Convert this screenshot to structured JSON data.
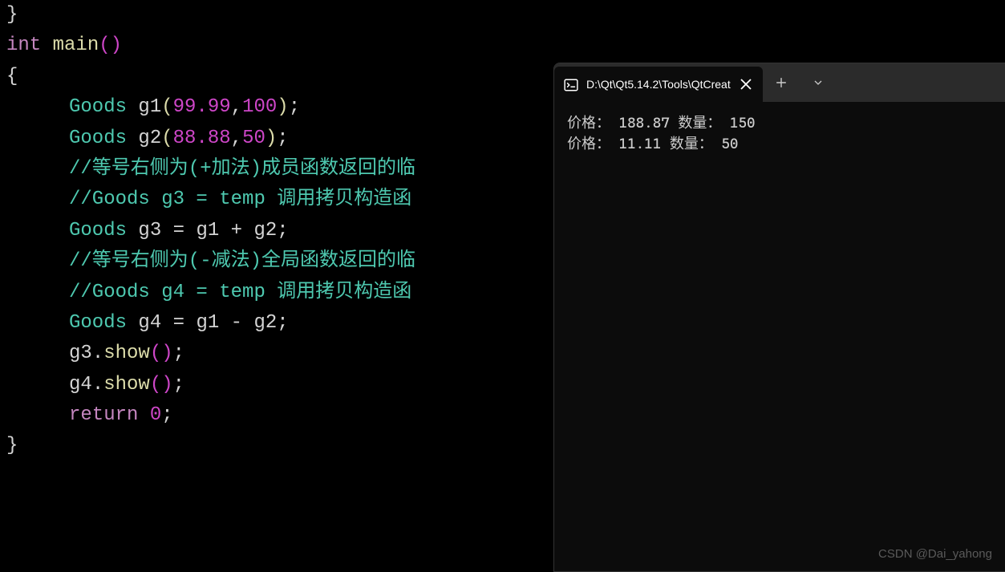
{
  "code": {
    "line0": "}",
    "kw_int": "int",
    "main": "main",
    "paren_open": "(",
    "paren_close": ")",
    "brace_open": "{",
    "brace_close": "}",
    "Goods": "Goods",
    "g1": "g1",
    "g1_v1": "99.99",
    "g1_v2": "100",
    "g2": "g2",
    "g2_v1": "88.88",
    "g2_v2": "50",
    "c1": "//等号右侧为(+加法)成员函数返回的临",
    "c2": "//Goods g3 = temp 调用拷贝构造函",
    "g3": "g3",
    "eq": "=",
    "plus": "+",
    "c3": "//等号右侧为(-减法)全局函数返回的临",
    "c4": "//Goods g4 = temp 调用拷贝构造函",
    "g4": "g4",
    "minus": "-",
    "show": "show",
    "dot": ".",
    "return": "return",
    "zero": "0",
    "semi": ";",
    "comma": ","
  },
  "terminal": {
    "tab_title": "D:\\Qt\\Qt5.14.2\\Tools\\QtCreat",
    "output": {
      "line1": "价格： 188.87 数量： 150",
      "line2": "价格： 11.11 数量： 50"
    }
  },
  "watermark": "CSDN @Dai_yahong"
}
